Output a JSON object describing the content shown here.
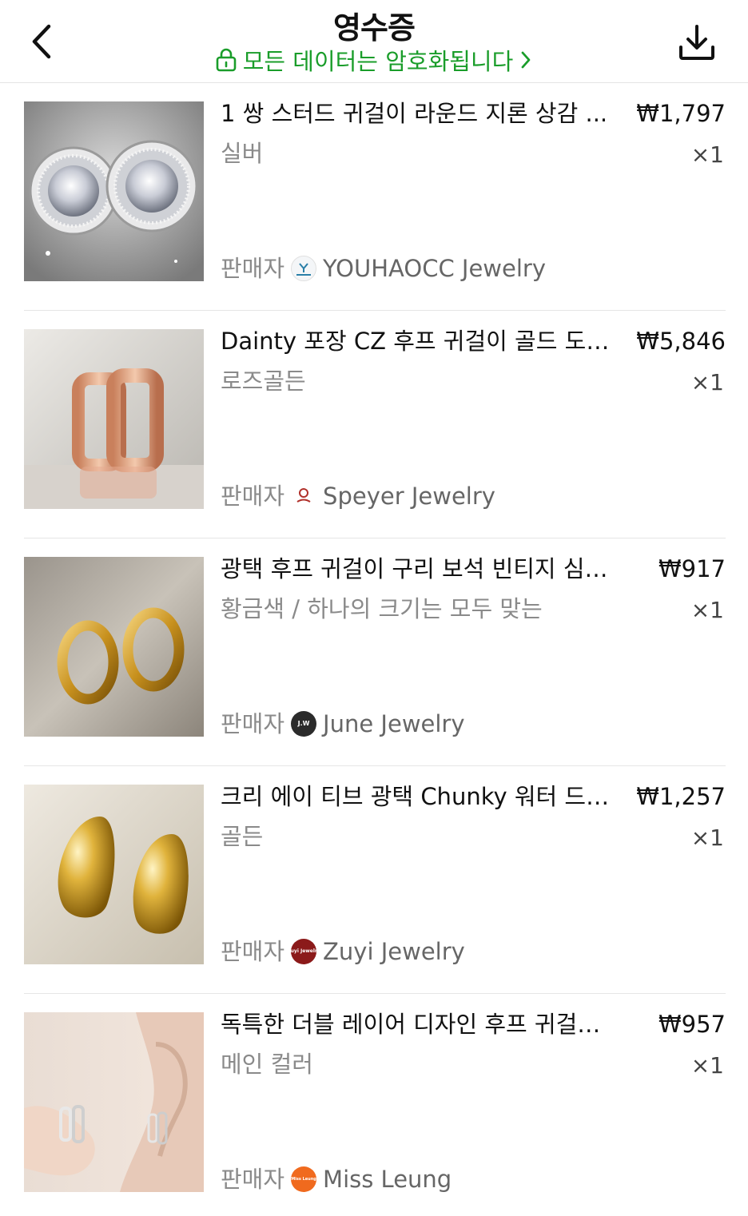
{
  "header": {
    "title": "영수증",
    "secure_text": "모든 데이터는 암호화됩니다",
    "icons": {
      "back": "back-arrow-icon",
      "lock": "lock-icon",
      "chevron": "chevron-right-icon",
      "download": "download-icon"
    },
    "accent_color": "#1a9d2a"
  },
  "items": [
    {
      "name": "1 쌍 스터드 귀걸이 라운드 지론 상감 ...",
      "price": "₩1,797",
      "variant": "실버",
      "qty": "×1",
      "seller_label": "판매자",
      "seller_logo_text": "YOUHAOCC",
      "seller_name": "YOUHAOCC Jewelry"
    },
    {
      "name": "Dainty 포장 CZ 후프 귀걸이 골드 도금...",
      "price": "₩5,846",
      "variant": "로즈골든",
      "qty": "×1",
      "seller_label": "판매자",
      "seller_logo_text": "Speyer",
      "seller_name": "Speyer Jewelry"
    },
    {
      "name": "광택 후프 귀걸이 구리 보석 빈티지 심플...",
      "price": "₩917",
      "variant": "황금색 / 하나의 크기는 모두 맞는",
      "qty": "×1",
      "seller_label": "판매자",
      "seller_logo_text": "J.W",
      "seller_name": "June Jewelry"
    },
    {
      "name": "크리 에이 티브 광택 Chunky 워터 드롭...",
      "price": "₩1,257",
      "variant": "골든",
      "qty": "×1",
      "seller_label": "판매자",
      "seller_logo_text": "Zuyi Jewelry",
      "seller_name": "Zuyi Jewelry"
    },
    {
      "name": "독특한 더블 레이어 디자인 후프 귀걸이 ...",
      "price": "₩957",
      "variant": "메인 컬러",
      "qty": "×1",
      "seller_label": "판매자",
      "seller_logo_text": "Miss Leung",
      "seller_name": "Miss Leung"
    }
  ]
}
